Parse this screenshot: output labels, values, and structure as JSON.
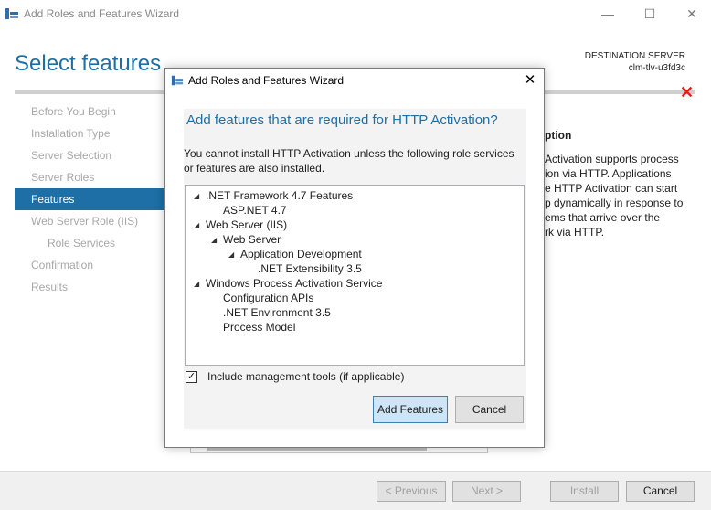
{
  "window": {
    "title": "Add Roles and Features Wizard",
    "controls": {
      "minimize": "—",
      "maximize": "☐",
      "close": "✕"
    }
  },
  "page": {
    "title": "Select features",
    "destination_label": "DESTINATION SERVER",
    "destination_server": "clm-tlv-u3fd3c"
  },
  "nav": {
    "items": [
      {
        "label": "Before You Begin"
      },
      {
        "label": "Installation Type"
      },
      {
        "label": "Server Selection"
      },
      {
        "label": "Server Roles"
      },
      {
        "label": "Features"
      },
      {
        "label": "Web Server Role (IIS)"
      },
      {
        "label": "Role Services"
      },
      {
        "label": "Confirmation"
      },
      {
        "label": "Results"
      }
    ],
    "active_index": 4
  },
  "description": {
    "title": "ption",
    "body": "Activation supports process\nion via HTTP. Applications\ne HTTP Activation can start\np dynamically in response to\nems that arrive over the\nrk via HTTP."
  },
  "footer": {
    "previous": "< Previous",
    "next": "Next >",
    "install": "Install",
    "cancel": "Cancel"
  },
  "dialog": {
    "title": "Add Roles and Features Wizard",
    "close": "✕",
    "heading": "Add features that are required for HTTP Activation?",
    "message": "You cannot install HTTP Activation unless the following role services or features are also installed.",
    "tree": [
      {
        "label": ".NET Framework 4.7 Features",
        "level": 0,
        "expanded": true
      },
      {
        "label": "ASP.NET 4.7",
        "level": 1,
        "expanded": false
      },
      {
        "label": "Web Server (IIS)",
        "level": 0,
        "expanded": true
      },
      {
        "label": "Web Server",
        "level": 1,
        "expanded": true
      },
      {
        "label": "Application Development",
        "level": 2,
        "expanded": true
      },
      {
        "label": ".NET Extensibility 3.5",
        "level": 3,
        "expanded": false
      },
      {
        "label": "Windows Process Activation Service",
        "level": 0,
        "expanded": true
      },
      {
        "label": "Configuration APIs",
        "level": 1,
        "expanded": false
      },
      {
        "label": ".NET Environment 3.5",
        "level": 1,
        "expanded": false
      },
      {
        "label": "Process Model",
        "level": 1,
        "expanded": false
      }
    ],
    "include_tools_label": "Include management tools (if applicable)",
    "include_tools_checked": true,
    "add_features": "Add Features",
    "cancel": "Cancel"
  }
}
